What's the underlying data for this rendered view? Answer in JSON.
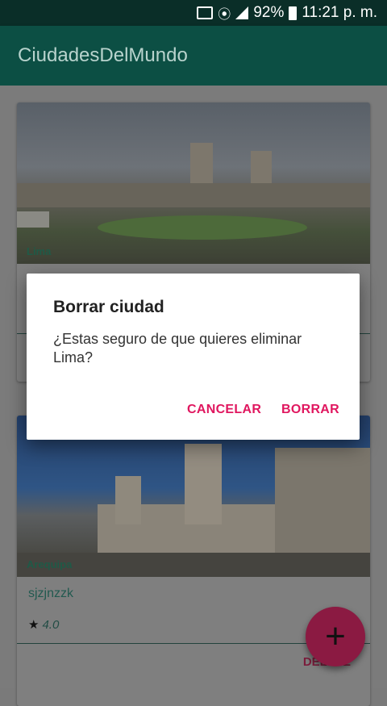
{
  "status_bar": {
    "battery": "92%",
    "time": "11:21 p. m.",
    "icons": [
      "cast-icon",
      "wifi-icon",
      "signal-icon",
      "battery-icon"
    ]
  },
  "app_bar": {
    "title": "CiudadesDelMundo"
  },
  "cards": [
    {
      "image_caption": "Lima",
      "name": "",
      "rating": "",
      "action": ""
    },
    {
      "image_caption": "Arequipa",
      "name": "sjzjnzzk",
      "rating": "4.0",
      "action": "DELETE"
    }
  ],
  "dialog": {
    "title": "Borrar ciudad",
    "message": "¿Estas seguro de que quieres eliminar Lima?",
    "cancel_label": "CANCELAR",
    "confirm_label": "BORRAR"
  },
  "fab": {
    "icon": "plus-icon",
    "label": "+"
  },
  "colors": {
    "primary": "#00796b",
    "primary_dark": "#004d40",
    "accent": "#e91e63"
  }
}
